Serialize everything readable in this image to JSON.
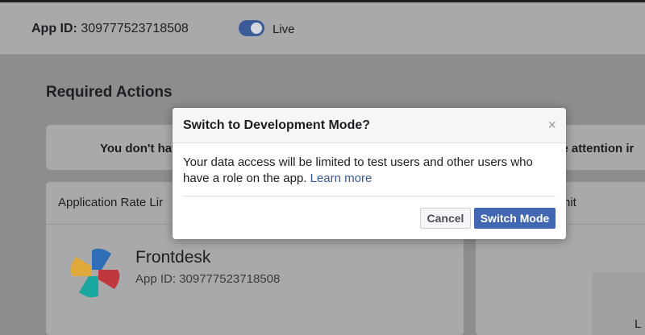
{
  "header": {
    "app_id_label": "App ID:",
    "app_id_value": "309777523718508",
    "mode_toggle_on": true,
    "mode_label": "Live"
  },
  "main": {
    "section_title": "Required Actions",
    "notice_left": "You don't hav",
    "notice_right": "ate attention ir"
  },
  "cards": {
    "rate_limit_title": "Application Rate Lir",
    "right_card_title": "nit",
    "app_name": "Frontdesk",
    "app_id_line": "App ID: 309777523718508",
    "right_card_snippet": "L"
  },
  "modal": {
    "title": "Switch to Development Mode?",
    "close_glyph": "×",
    "body_text": "Your data access will be limited to test users and other users who have a role on the app.",
    "learn_more": "Learn more",
    "cancel_label": "Cancel",
    "confirm_label": "Switch Mode"
  },
  "colors": {
    "accent": "#4267b2",
    "toggle": "#3a5b98",
    "overlay": "#8c8d8f"
  },
  "icons": {
    "app_logo": "frontdesk-logo-icon",
    "close": "close-icon"
  }
}
